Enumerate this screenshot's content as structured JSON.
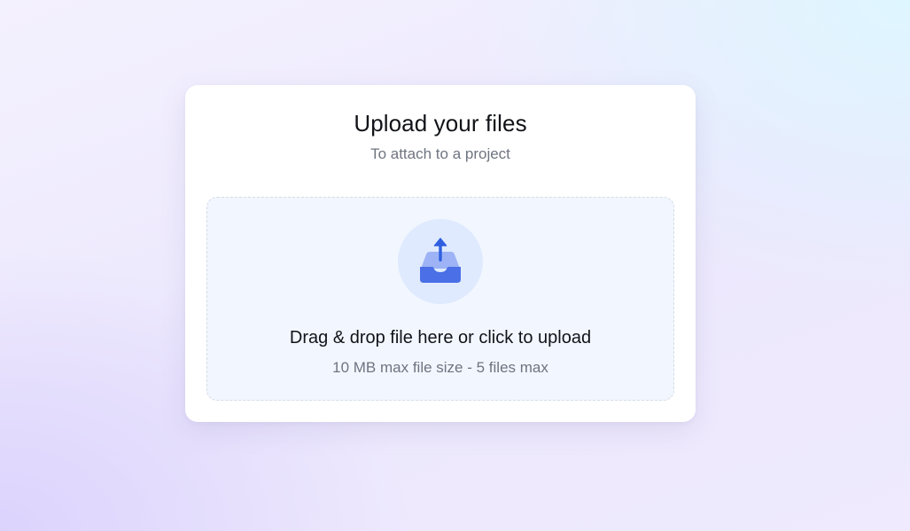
{
  "card": {
    "title": "Upload your files",
    "subtitle": "To attach to a project"
  },
  "dropzone": {
    "icon": "inbox-upload-icon",
    "label": "Drag & drop file here or click to upload",
    "hint": "10 MB max file size - 5 files max"
  },
  "colors": {
    "accent": "#4a6fe6",
    "accent_light": "#9db3f5",
    "icon_bg": "#dfeafe",
    "dropzone_bg": "#f2f7ff"
  }
}
